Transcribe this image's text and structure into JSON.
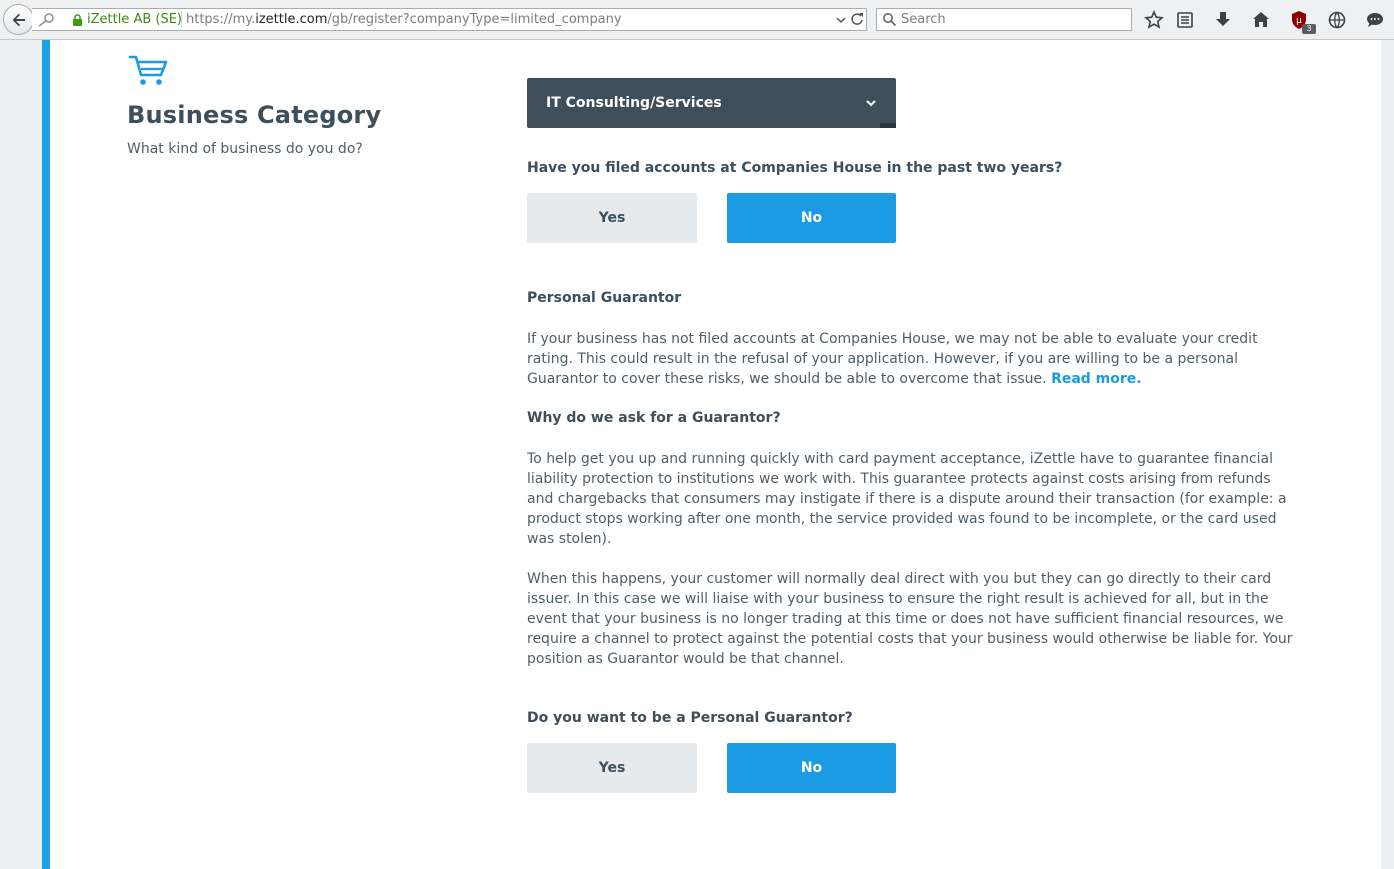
{
  "browser": {
    "site_identity": "iZettle AB (SE)",
    "url_prefix": "https://my.",
    "url_domain": "izettle.com",
    "url_path": "/gb/register?companyType=limited_company",
    "search_placeholder": "Search",
    "ublock_count": "3"
  },
  "sidebar": {
    "title": "Business Category",
    "subtitle": "What kind of business do you do?"
  },
  "form": {
    "category_value": "IT Consulting/Services",
    "q1": {
      "question": "Have you filed accounts at Companies House in the past two years?",
      "yes_label": "Yes",
      "no_label": "No",
      "selected": "No"
    },
    "guarantor": {
      "heading": "Personal Guarantor",
      "para1": "If your business has not filed accounts at Companies House, we may not be able to evaluate your credit rating. This could result in the refusal of your application. However, if you are willing to be a personal Guarantor to cover these risks, we should be able to overcome that issue.",
      "read_more": "Read more.",
      "why_heading": "Why do we ask for a Guarantor?",
      "para2": "To help get you up and running quickly with card payment acceptance, iZettle have to guarantee financial liability protection to institutions we work with. This guarantee protects against costs arising from refunds and chargebacks that consumers may instigate if there is a dispute around their transaction (for example: a product stops working after one month, the service provided was found to be incomplete, or the card used was stolen).",
      "para3": "When this happens, your customer will normally deal direct with you but they can go directly to their card issuer. In this case we will liaise with your business to ensure the right result is achieved for all, but in the event that your business is no longer trading at this time or does not have sufficient financial resources, we require a channel to protect against the potential costs that your business would otherwise be liable for. Your position as Guarantor would be that channel."
    },
    "q2": {
      "question": "Do you want to be a Personal Guarantor?",
      "yes_label": "Yes",
      "no_label": "No",
      "selected": "No"
    }
  },
  "colors": {
    "accent": "#1a9be3",
    "stripe": "#1aa3e6",
    "select_bg": "#3f4e58",
    "text": "#3d4f5c"
  }
}
